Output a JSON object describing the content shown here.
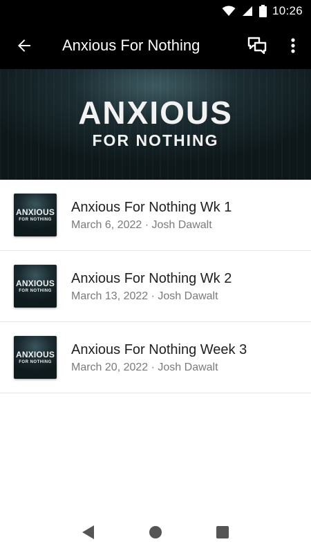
{
  "status_bar": {
    "time": "10:26"
  },
  "app_bar": {
    "title": "Anxious For Nothing"
  },
  "hero": {
    "line1": "ANXIOUS",
    "line2": "FOR NOTHING"
  },
  "thumbnail": {
    "line1": "ANXIOUS",
    "line2": "FOR NOTHING"
  },
  "items": [
    {
      "title": "Anxious For Nothing Wk 1",
      "subtitle": "March 6, 2022 · Josh Dawalt"
    },
    {
      "title": "Anxious For Nothing Wk 2",
      "subtitle": "March 13, 2022 · Josh Dawalt"
    },
    {
      "title": "Anxious For Nothing Week 3",
      "subtitle": "March 20, 2022 · Josh Dawalt"
    }
  ],
  "icons": {
    "back": "arrow-back-icon",
    "chat": "chat-bubbles-icon",
    "more": "more-vert-icon",
    "wifi": "wifi-icon",
    "signal": "signal-icon",
    "battery": "battery-icon",
    "nav_back": "nav-back-icon",
    "nav_home": "nav-home-icon",
    "nav_recents": "nav-recents-icon"
  },
  "colors": {
    "app_bar": "#000000",
    "hero_bg": "#1b2c31",
    "subtitle": "#7a7a7a"
  }
}
